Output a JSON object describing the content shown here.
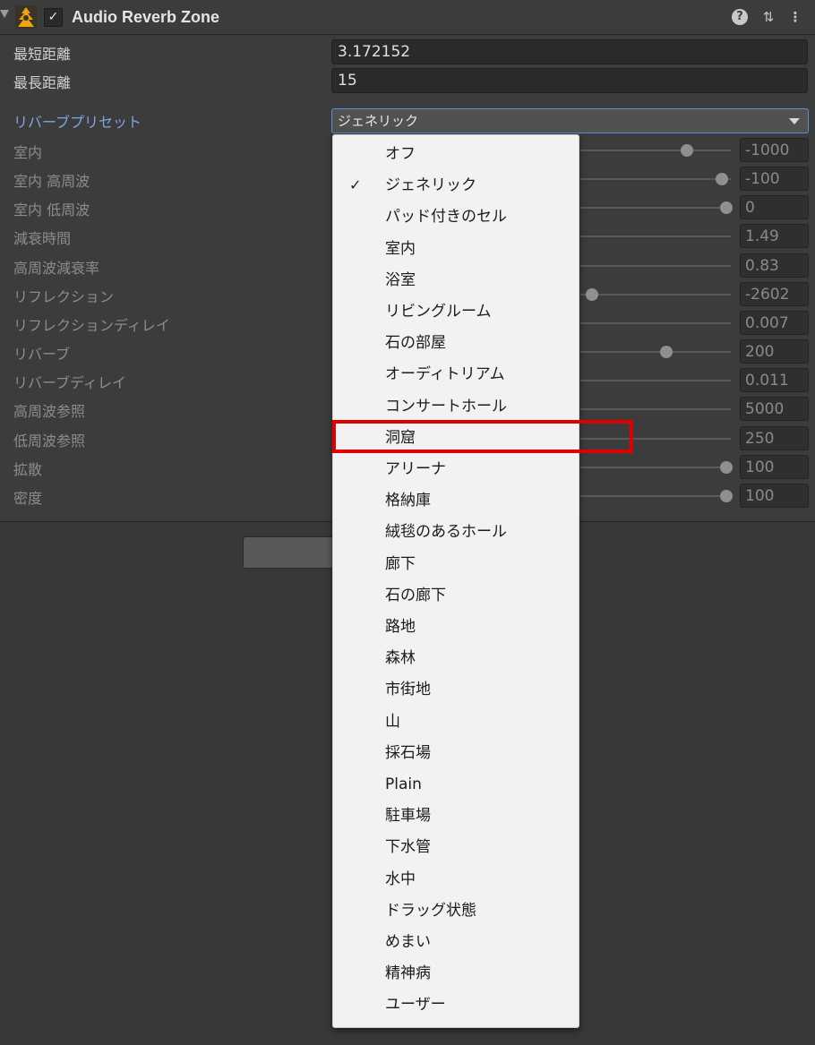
{
  "component": {
    "title": "Audio Reverb Zone",
    "enabled_glyph": "✓",
    "icons": {
      "component": "audio-reverb-zone-icon",
      "help": "help-icon",
      "presets": "presets-icon",
      "menu": "kebab-menu-icon"
    },
    "help_glyph": "?",
    "presets_glyph": "⇅",
    "menu_glyph": "⋮"
  },
  "fields": {
    "min_distance": {
      "label": "最短距離",
      "value": "3.172152"
    },
    "max_distance": {
      "label": "最長距離",
      "value": "15"
    },
    "reverb_preset": {
      "label": "リバーブプリセット",
      "value": "ジェネリック"
    }
  },
  "params": [
    {
      "label": "室内",
      "value": "-1000",
      "level": 0.71
    },
    {
      "label": "室内 高周波",
      "value": "-100",
      "level": 0.94
    },
    {
      "label": "室内 低周波",
      "value": "0",
      "level": 0.97
    },
    {
      "label": "減衰時間",
      "value": "1.49",
      "level": null
    },
    {
      "label": "高周波減衰率",
      "value": "0.83",
      "level": null
    },
    {
      "label": "リフレクション",
      "value": "-2602",
      "level": 0.08
    },
    {
      "label": "リフレクションディレイ",
      "value": "0.007",
      "level": null
    },
    {
      "label": "リバーブ",
      "value": "200",
      "level": 0.57
    },
    {
      "label": "リバーブディレイ",
      "value": "0.011",
      "level": null
    },
    {
      "label": "高周波参照",
      "value": "5000",
      "level": null
    },
    {
      "label": "低周波参照",
      "value": "250",
      "level": null
    },
    {
      "label": "拡散",
      "value": "100",
      "level": 0.97
    },
    {
      "label": "密度",
      "value": "100",
      "level": 0.97
    }
  ],
  "preset_menu": {
    "selected_index": 1,
    "highlighted_index": 9,
    "check_glyph": "✓",
    "items": [
      "オフ",
      "ジェネリック",
      "パッド付きのセル",
      "室内",
      "浴室",
      "リビングルーム",
      "石の部屋",
      "オーディトリアム",
      "コンサートホール",
      "洞窟",
      "アリーナ",
      "格納庫",
      "絨毯のあるホール",
      "廊下",
      "石の廊下",
      "路地",
      "森林",
      "市街地",
      "山",
      "採石場",
      "Plain",
      "駐車場",
      "下水管",
      "水中",
      "ドラッグ状態",
      "めまい",
      "精神病",
      "ユーザー"
    ]
  },
  "colors": {
    "highlight_border": "#e00000",
    "preset_label": "#7ea6e0",
    "focus_border": "#5b8ed6"
  }
}
